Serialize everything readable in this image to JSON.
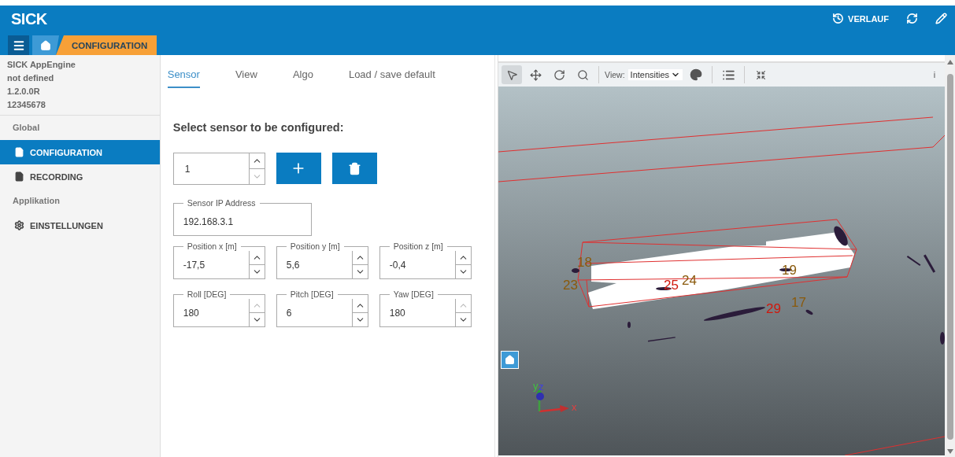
{
  "header": {
    "logo": "SICK",
    "actions": [
      {
        "kind": "history",
        "label": "VERLAUF"
      },
      {
        "kind": "refresh"
      },
      {
        "kind": "edit"
      }
    ],
    "breadcrumb": [
      {
        "kind": "menu"
      },
      {
        "kind": "home"
      },
      {
        "kind": "page",
        "label": "CONFIGURATION"
      }
    ]
  },
  "sidebar": {
    "device_info": [
      "SICK AppEngine",
      "not defined",
      "1.2.0.0R",
      "12345678"
    ],
    "sections": [
      {
        "title": "Global",
        "items": [
          {
            "label": "CONFIGURATION",
            "kind": "file",
            "selected": true
          },
          {
            "label": "RECORDING",
            "kind": "file",
            "selected": false
          }
        ]
      },
      {
        "title": "Applikation",
        "items": [
          {
            "label": "EINSTELLUNGEN",
            "kind": "gears",
            "selected": false
          }
        ]
      }
    ]
  },
  "tabs": [
    {
      "label": "Sensor",
      "selected": true
    },
    {
      "label": "View",
      "selected": false
    },
    {
      "label": "Algo",
      "selected": false
    },
    {
      "label": "Load / save default",
      "selected": false
    }
  ],
  "sensor_form": {
    "heading": "Select sensor to be configured:",
    "sensor_number": {
      "value": "1",
      "up_disabled": false,
      "down_disabled": true
    },
    "ip_address": {
      "label": "Sensor IP Address",
      "value": "192.168.3.1"
    },
    "pose_fields": [
      {
        "label": "Position x [m]",
        "value": "-17,5",
        "up_disabled": false,
        "down_disabled": false
      },
      {
        "label": "Position y [m]",
        "value": "5,6",
        "up_disabled": false,
        "down_disabled": false
      },
      {
        "label": "Position z [m]",
        "value": "-0,4",
        "up_disabled": false,
        "down_disabled": false
      },
      {
        "label": "Roll [DEG]",
        "value": "180",
        "up_disabled": true,
        "down_disabled": false
      },
      {
        "label": "Pitch [DEG]",
        "value": "6",
        "up_disabled": false,
        "down_disabled": false
      },
      {
        "label": "Yaw [DEG]",
        "value": "180",
        "up_disabled": true,
        "down_disabled": false
      }
    ]
  },
  "viewer": {
    "tools": [
      {
        "kind": "pointer",
        "selected": true
      },
      {
        "kind": "pan",
        "selected": false
      },
      {
        "kind": "rotate",
        "selected": false
      },
      {
        "kind": "zoom",
        "selected": false
      }
    ],
    "view_label": "View:",
    "view_select": "Intensities",
    "info": "i",
    "object_labels": [
      {
        "text": "18",
        "color": "#8a5a0c"
      },
      {
        "text": "23",
        "color": "#8a5a0c"
      },
      {
        "text": "25",
        "color": "#d0180c"
      },
      {
        "text": "24",
        "color": "#8a5a0c"
      },
      {
        "text": "19",
        "color": "#8a5a0c"
      },
      {
        "text": "29",
        "color": "#d0180c"
      },
      {
        "text": "17",
        "color": "#8a5a0c"
      }
    ],
    "axes": [
      "x",
      "y",
      "z"
    ]
  }
}
